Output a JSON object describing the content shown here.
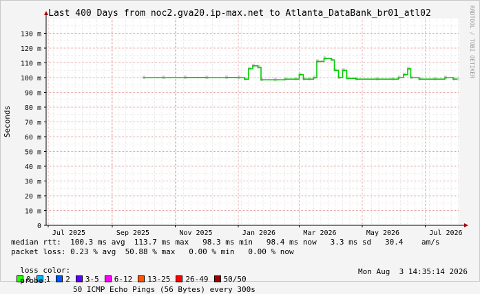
{
  "chart_data": {
    "type": "line",
    "title": "Last 400 Days from noc2.gva20.ip-max.net to Atlanta_DataBank_br01_atl02",
    "ylabel": "Seconds",
    "xlabel": "",
    "ylim": [
      0,
      0.14
    ],
    "yticks": [
      0,
      0.01,
      0.02,
      0.03,
      0.04,
      0.05,
      0.06,
      0.07,
      0.08,
      0.09,
      0.1,
      0.11,
      0.12,
      0.13
    ],
    "ytick_labels": [
      "0",
      "10 m",
      "20 m",
      "30 m",
      "40 m",
      "50 m",
      "60 m",
      "70 m",
      "80 m",
      "90 m",
      "100 m",
      "110 m",
      "120 m",
      "130 m"
    ],
    "xlim": [
      "2025-06-29",
      "2026-08-03"
    ],
    "xtick_labels": [
      {
        "date": "2025-07-01",
        "label": "Jul 2025"
      },
      {
        "date": "2025-09-01",
        "label": "Sep 2025"
      },
      {
        "date": "2025-11-01",
        "label": "Nov 2025"
      },
      {
        "date": "2026-01-01",
        "label": "Jan 2026"
      },
      {
        "date": "2026-03-01",
        "label": "Mar 2026"
      },
      {
        "date": "2026-05-01",
        "label": "May 2026"
      },
      {
        "date": "2026-07-01",
        "label": "Jul 2026"
      }
    ],
    "grid": true,
    "series": [
      {
        "color": "#00cc00",
        "points": [
          [
            "2025-10-01",
            0.1
          ],
          [
            "2025-10-20",
            0.1
          ],
          [
            "2025-11-10",
            0.1001
          ],
          [
            "2025-12-01",
            0.1
          ],
          [
            "2025-12-20",
            0.1001
          ],
          [
            "2026-01-01",
            0.1
          ],
          [
            "2026-01-07",
            0.099
          ],
          [
            "2026-01-11",
            0.106
          ],
          [
            "2026-01-15",
            0.108
          ],
          [
            "2026-01-20",
            0.107
          ],
          [
            "2026-01-23",
            0.0985
          ],
          [
            "2026-02-05",
            0.0985
          ],
          [
            "2026-02-15",
            0.099
          ],
          [
            "2026-02-25",
            0.099
          ],
          [
            "2026-03-01",
            0.102
          ],
          [
            "2026-03-05",
            0.099
          ],
          [
            "2026-03-10",
            0.099
          ],
          [
            "2026-03-15",
            0.1
          ],
          [
            "2026-03-18",
            0.111
          ],
          [
            "2026-03-25",
            0.113
          ],
          [
            "2026-04-01",
            0.112
          ],
          [
            "2026-04-04",
            0.105
          ],
          [
            "2026-04-08",
            0.1
          ],
          [
            "2026-04-12",
            0.105
          ],
          [
            "2026-04-16",
            0.0995
          ],
          [
            "2026-04-25",
            0.099
          ],
          [
            "2026-05-15",
            0.099
          ],
          [
            "2026-05-30",
            0.099
          ],
          [
            "2026-06-05",
            0.1
          ],
          [
            "2026-06-10",
            0.102
          ],
          [
            "2026-06-14",
            0.106
          ],
          [
            "2026-06-17",
            0.1
          ],
          [
            "2026-06-25",
            0.099
          ],
          [
            "2026-07-10",
            0.099
          ],
          [
            "2026-07-20",
            0.1
          ],
          [
            "2026-07-28",
            0.099
          ],
          [
            "2026-08-01",
            0.099
          ]
        ]
      }
    ]
  },
  "watermark": "RRDTOOL / TOBI OETIKER",
  "stats": {
    "median_rtt": "median rtt:  100.3 ms avg  113.7 ms max   98.3 ms min   98.4 ms now   3.3 ms sd   30.4    am/s",
    "packet_loss": "packet loss: 0.23 % avg  50.88 % max   0.00 % min   0.00 % now",
    "loss_color_label": "loss color:",
    "loss_colors": [
      {
        "label": "0",
        "color": "#26ff00"
      },
      {
        "label": "1",
        "color": "#00b8ff"
      },
      {
        "label": "2",
        "color": "#0059ff"
      },
      {
        "label": "3-5",
        "color": "#5e00ff"
      },
      {
        "label": "6-12",
        "color": "#ff00ff"
      },
      {
        "label": "13-25",
        "color": "#ff5500"
      },
      {
        "label": "26-49",
        "color": "#ff0000"
      },
      {
        "label": "50/50",
        "color": "#a10000"
      }
    ],
    "probe_label": "probe:",
    "probe_text": "50 ICMP Echo Pings (56 Bytes) every 300s",
    "timestamp": "Mon Aug  3 14:35:14 2026"
  }
}
